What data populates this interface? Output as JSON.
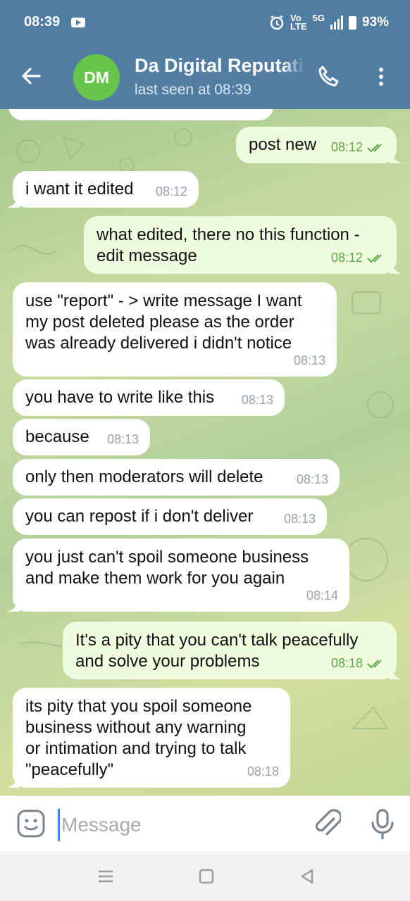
{
  "status": {
    "time": "08:39",
    "volte": "Vo\nLTE",
    "net": "5G",
    "battery": "93%"
  },
  "header": {
    "avatar_initials": "DM",
    "title": "Da Digital Reputation",
    "subtitle": "last seen at 08:39"
  },
  "messages": [
    {
      "text": "post new",
      "time": "08:12"
    },
    {
      "text": "i want it edited",
      "time": "08:12"
    },
    {
      "text": "what edited, there no this function - edit message",
      "time": "08:12"
    },
    {
      "text": "use \"report\" - > write message I want my post deleted please as the order was already delivered i didn't notice",
      "time": "08:13"
    },
    {
      "text": "you have to write like this",
      "time": "08:13"
    },
    {
      "text": "because",
      "time": "08:13"
    },
    {
      "text": "only then moderators will delete",
      "time": "08:13"
    },
    {
      "text": "you can repost if i don't deliver",
      "time": "08:13"
    },
    {
      "text": "you just can't spoil someone business and make them work for you again",
      "time": "08:14"
    },
    {
      "text": "It's a pity that you can't talk peacefully and solve your problems",
      "time": "08:18"
    },
    {
      "text": "its pity that you spoil someone business without any warning or intimation and trying to talk \"peacefully\"",
      "time": "08:18"
    }
  ],
  "composer": {
    "placeholder": "Message"
  },
  "colors": {
    "header": "#527da3",
    "avatar": "#66c54a",
    "incoming": "#ffffff",
    "outgoing": "#effdde",
    "read_check": "#5ea74a"
  }
}
